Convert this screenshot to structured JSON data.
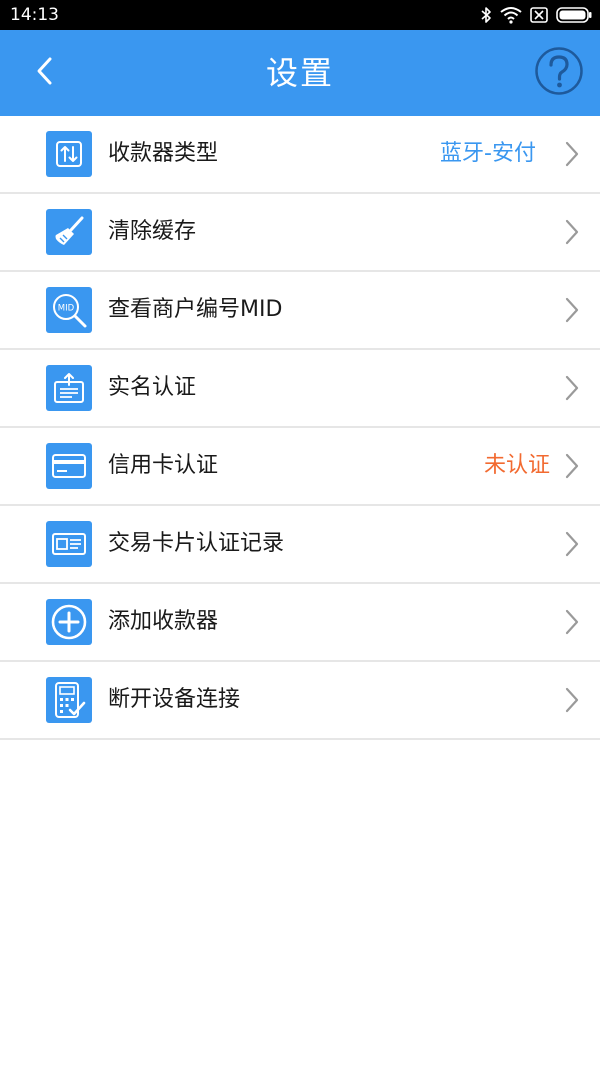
{
  "status_bar": {
    "time": "14:13",
    "icons": [
      "bluetooth-icon",
      "wifi-icon",
      "sim-blocked-icon",
      "battery-icon"
    ]
  },
  "header": {
    "title": "设置",
    "back_icon": "chevron-left-icon",
    "help_icon": "question-circle-icon"
  },
  "colors": {
    "primary": "#3a97f0",
    "value_blue": "#3a97f0",
    "value_orange": "#f26a30",
    "divider": "#e6e6e6",
    "chevron": "#9a9a9a"
  },
  "settings": {
    "items": [
      {
        "label": "收款器类型",
        "value": "蓝牙-安付",
        "icon": "transfer-arrows-icon"
      },
      {
        "label": "清除缓存",
        "value": "",
        "icon": "broom-icon"
      },
      {
        "label": "查看商户编号MID",
        "value": "",
        "icon": "mid-search-icon"
      },
      {
        "label": "实名认证",
        "value": "",
        "icon": "id-upload-icon"
      },
      {
        "label": "信用卡认证",
        "value": "未认证",
        "icon": "credit-card-icon"
      },
      {
        "label": "交易卡片认证记录",
        "value": "",
        "icon": "id-card-icon"
      },
      {
        "label": "添加收款器",
        "value": "",
        "icon": "plus-circle-icon"
      },
      {
        "label": "断开设备连接",
        "value": "",
        "icon": "pos-device-icon"
      }
    ]
  }
}
